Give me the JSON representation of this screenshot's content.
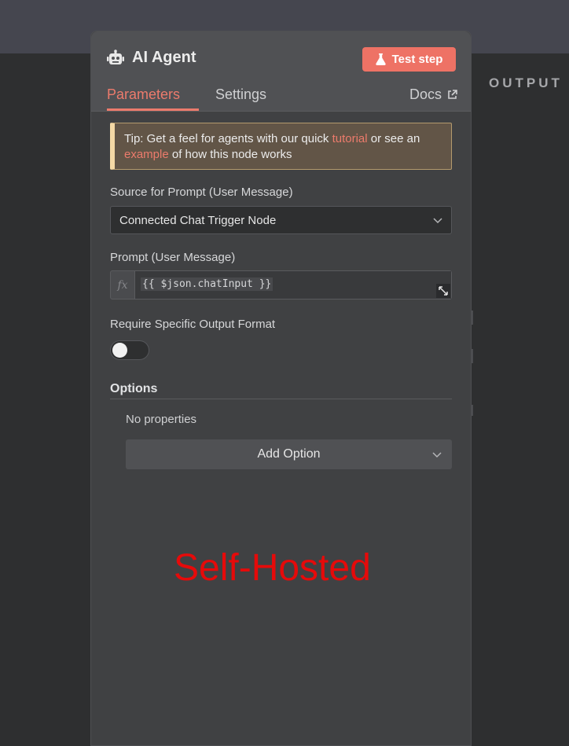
{
  "canvas": {
    "output_label": "OUTPUT"
  },
  "node": {
    "title": "AI Agent",
    "test_button_label": "Test step",
    "tabs": [
      {
        "label": "Parameters",
        "active": true
      },
      {
        "label": "Settings",
        "active": false
      }
    ],
    "docs_label": "Docs"
  },
  "tip": {
    "prefix": "Tip: Get a feel for agents with our quick ",
    "link1": "tutorial",
    "middle": " or see an ",
    "link2": "example",
    "suffix": " of how this node works"
  },
  "fields": {
    "source_label": "Source for Prompt (User Message)",
    "source_value": "Connected Chat Trigger Node",
    "prompt_label": "Prompt (User Message)",
    "prompt_fx": "fx",
    "prompt_value": "{{ $json.chatInput }}",
    "output_format_label": "Require Specific Output Format",
    "output_format_enabled": false
  },
  "options": {
    "title": "Options",
    "empty_text": "No properties",
    "add_button_label": "Add Option"
  },
  "watermark": "Self-Hosted",
  "colors": {
    "accent": "#ee7265",
    "link": "#ec7b6c",
    "panel": "#404143",
    "canvas": "#2e2f30",
    "tip_border": "#f4d8a5",
    "watermark": "#e60a0a"
  },
  "icons": {
    "title": "robot-icon",
    "test": "flask-icon",
    "docs": "external-link-icon",
    "select": "chevron-down-icon",
    "expand": "expand-icon"
  }
}
